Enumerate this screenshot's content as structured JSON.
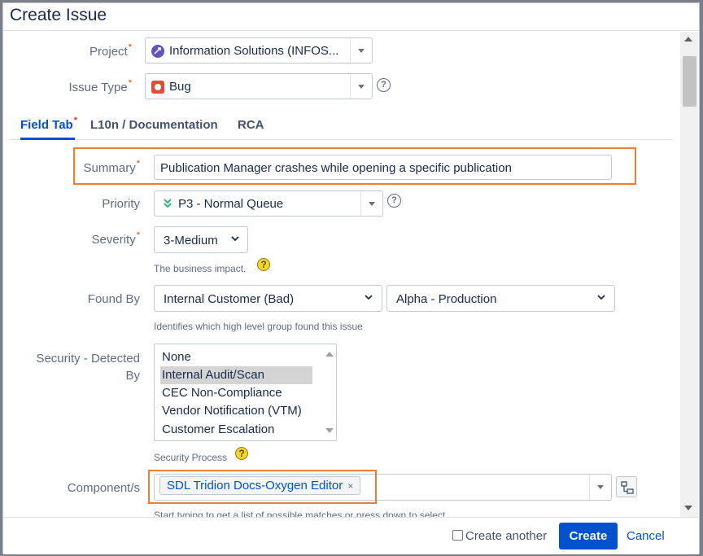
{
  "dialog": {
    "title": "Create Issue"
  },
  "fields": {
    "project": {
      "label": "Project",
      "required_mark": "*",
      "value": "Information Solutions (INFOS..."
    },
    "issue_type": {
      "label": "Issue Type",
      "required_mark": "*",
      "value": "Bug",
      "help": "?"
    },
    "summary": {
      "label": "Summary",
      "required_mark": "*",
      "value": "Publication Manager crashes while opening a specific publication"
    },
    "priority": {
      "label": "Priority",
      "value": "P3 - Normal Queue",
      "help": "?"
    },
    "severity": {
      "label": "Severity",
      "required_mark": "*",
      "value": "3-Medium",
      "description": "The business impact."
    },
    "found_by": {
      "label": "Found By",
      "value": "Internal Customer (Bad)",
      "value2": "Alpha - Production",
      "description": "Identifies which high level group found this issue"
    },
    "security_detected_by": {
      "label_line1": "Security - Detected",
      "label_line2": "By",
      "options": [
        "None",
        "Internal Audit/Scan",
        "CEC Non-Compliance",
        "Vendor Notification (VTM)",
        "Customer Escalation"
      ],
      "selected": "Internal Audit/Scan",
      "description": "Security Process"
    },
    "components": {
      "label": "Component/s",
      "chip": "SDL Tridion Docs-Oxygen Editor",
      "chip_remove": "×",
      "hint": "Start typing to get a list of possible matches or press down to select."
    }
  },
  "tabs": [
    {
      "label": "Field Tab",
      "required_mark": "*",
      "active": true
    },
    {
      "label": "L10n / Documentation"
    },
    {
      "label": "RCA"
    }
  ],
  "footer": {
    "create_another": "Create another",
    "create": "Create",
    "cancel": "Cancel"
  },
  "help_glyph": "?",
  "colors": {
    "accent": "#0052cc",
    "required": "#de350b",
    "highlight": "#ed7d31",
    "bug": "#e5493a"
  }
}
